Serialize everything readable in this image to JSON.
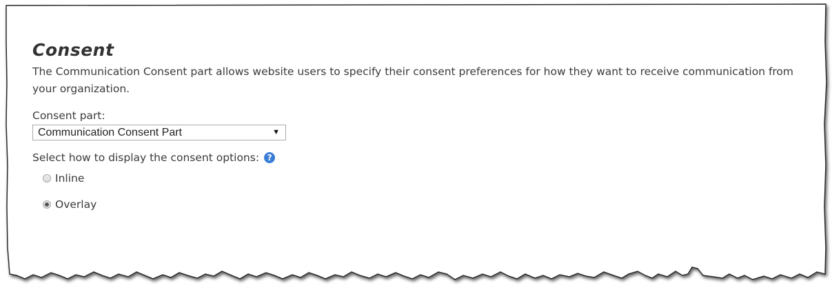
{
  "section": {
    "title": "Consent",
    "description": "The Communication Consent part allows website users to specify their consent preferences for how they want to receive communication from your organization."
  },
  "consent_part": {
    "label": "Consent part:",
    "selected": "Communication Consent Part"
  },
  "display_options": {
    "label": "Select how to display the consent options:",
    "options": [
      {
        "label": "Inline",
        "checked": false
      },
      {
        "label": "Overlay",
        "checked": true
      }
    ]
  },
  "colors": {
    "help_icon": "#3a7dd6",
    "border": "#333333"
  },
  "icons": {
    "help": "question-circle-icon",
    "dropdown": "triangle-down-icon"
  }
}
